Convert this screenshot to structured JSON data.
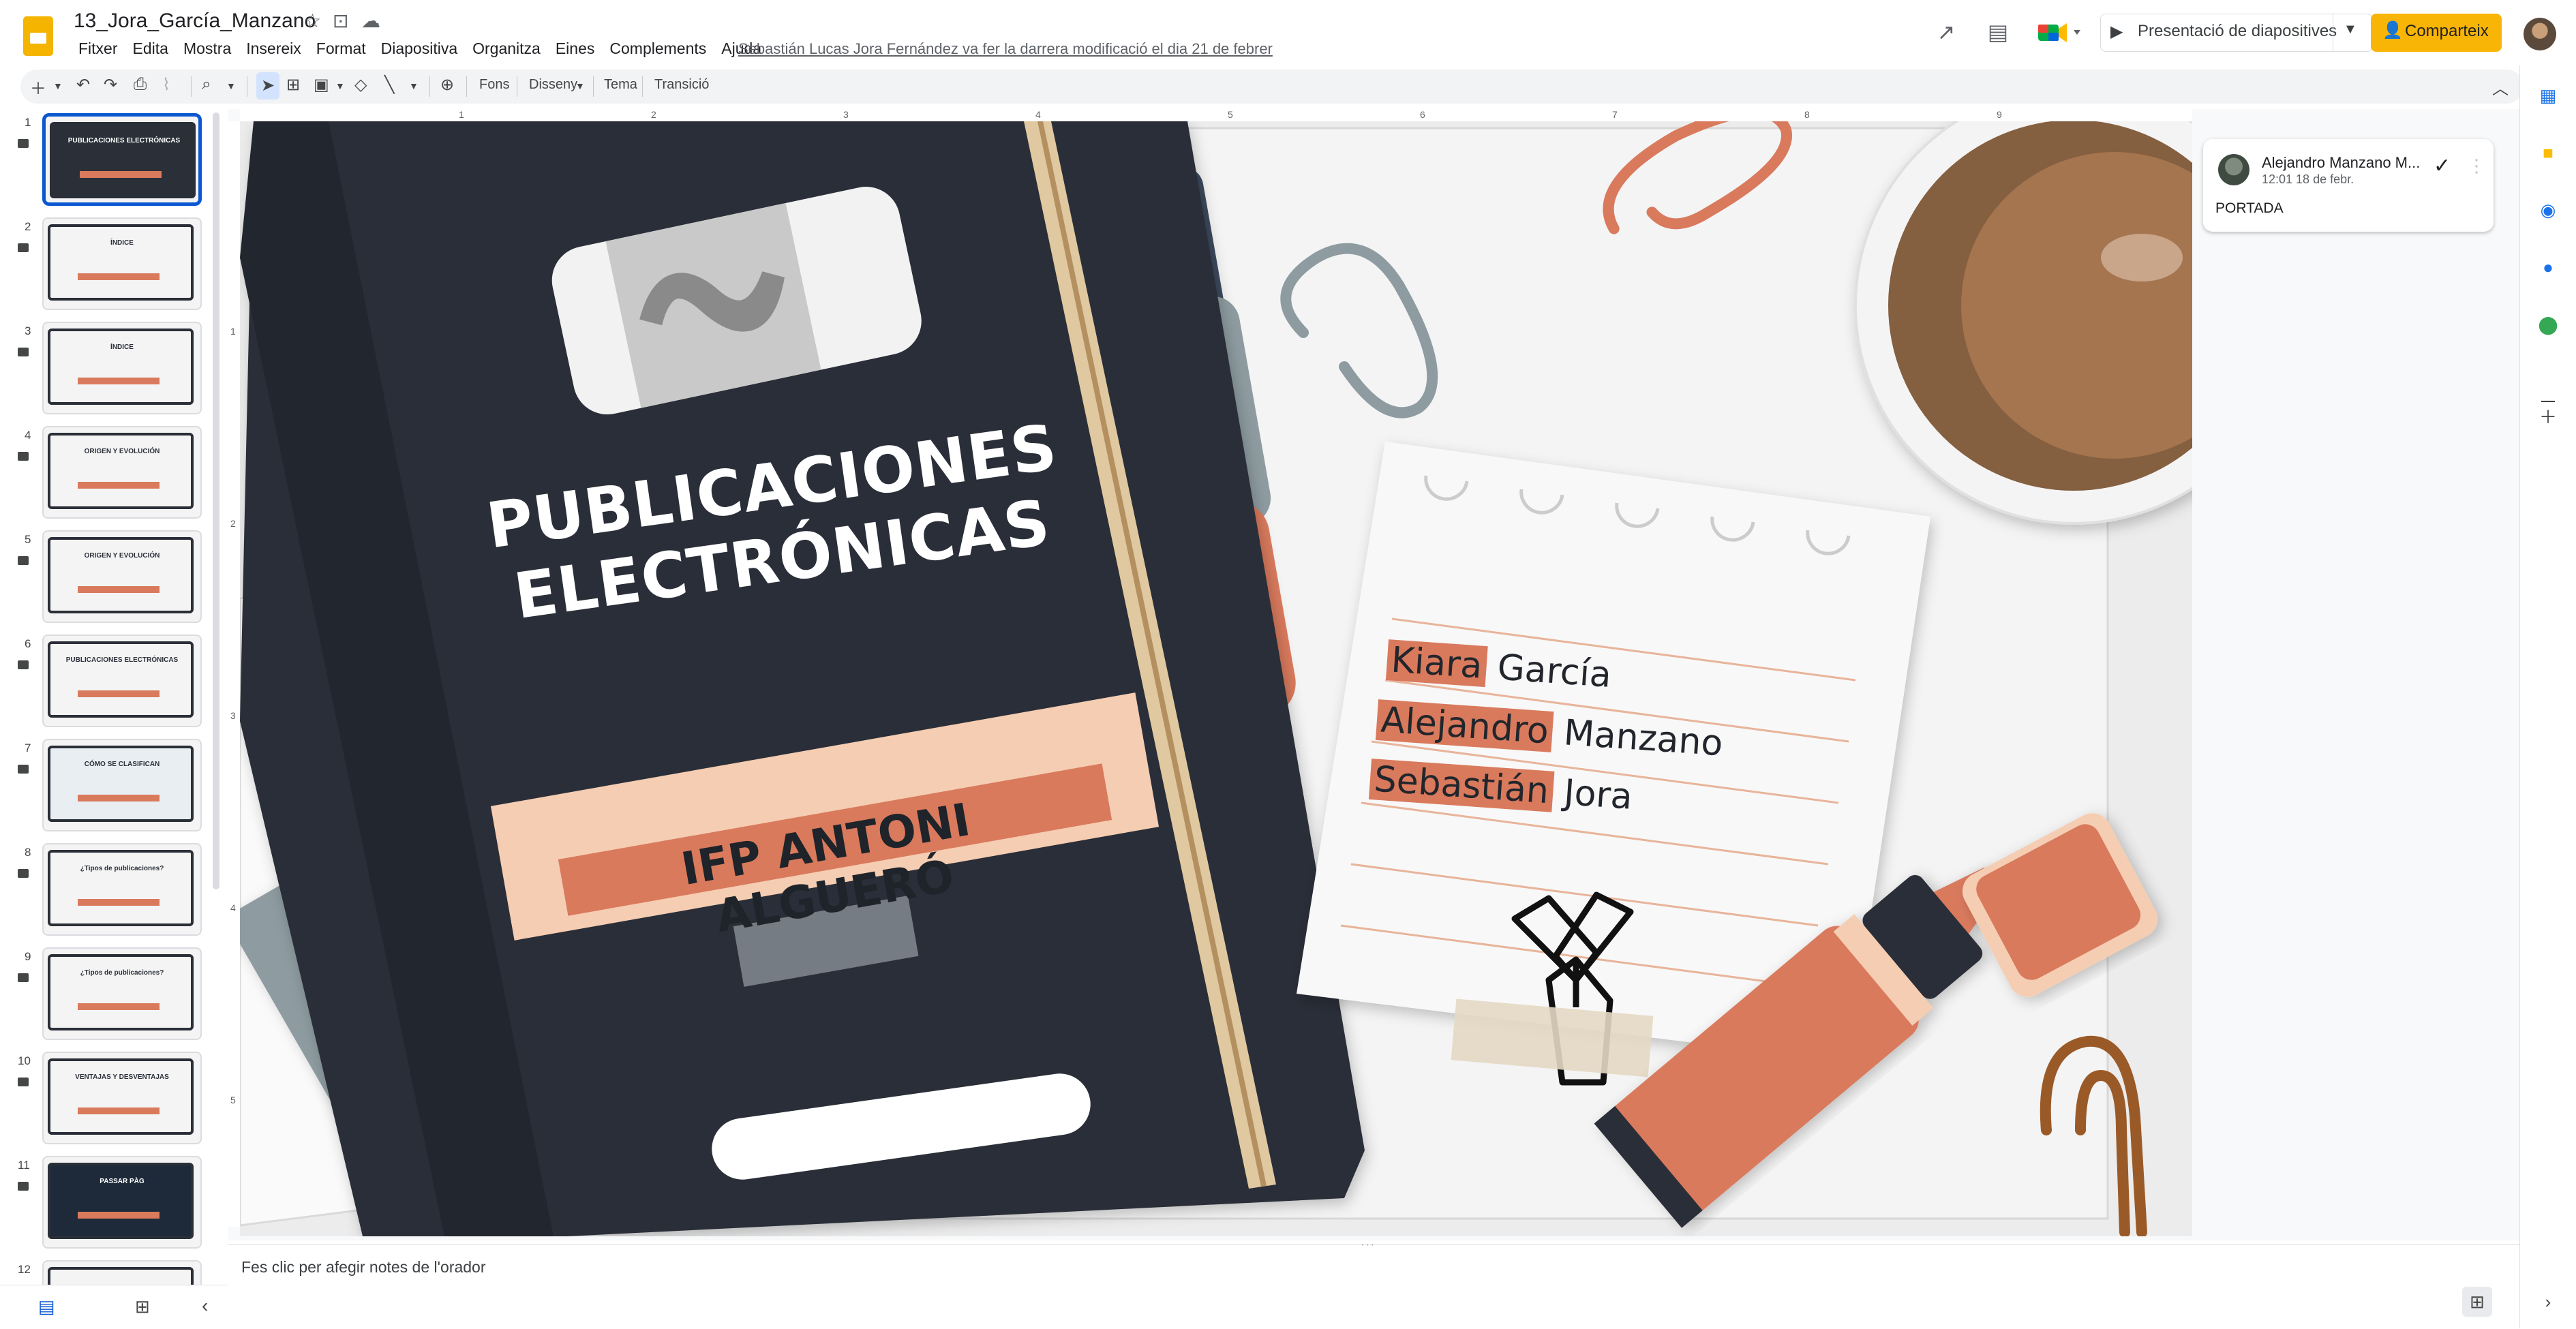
{
  "app": {
    "doc_title": "13_Jora_García_Manzano",
    "menu": [
      "Fitxer",
      "Edita",
      "Mostra",
      "Insereix",
      "Format",
      "Diapositiva",
      "Organitza",
      "Eines",
      "Complements",
      "Ajuda"
    ],
    "last_edit": "Sebastián Lucas Jora Fernández va fer la darrera modificació el dia 21 de febrer",
    "present_label": "Presentació de diapositives",
    "share_label": "Comparteix"
  },
  "toolbar": {
    "background_label": "Fons",
    "layout_label": "Disseny",
    "theme_label": "Tema",
    "transition_label": "Transició"
  },
  "ruler": {
    "top": [
      "1",
      "2",
      "3",
      "4",
      "5",
      "6",
      "7",
      "8",
      "9"
    ],
    "left": [
      "1",
      "2",
      "3",
      "4",
      "5"
    ]
  },
  "filmstrip": {
    "slides": [
      {
        "num": "1",
        "title": "PUBLICACIONES ELECTRÓNICAS"
      },
      {
        "num": "2",
        "title": "ÍNDICE"
      },
      {
        "num": "3",
        "title": "ÍNDICE"
      },
      {
        "num": "4",
        "title": "ORIGEN Y EVOLUCIÓN"
      },
      {
        "num": "5",
        "title": "ORIGEN Y EVOLUCIÓN"
      },
      {
        "num": "6",
        "title": "PUBLICACIONES ELECTRÓNICAS"
      },
      {
        "num": "7",
        "title": "CÓMO SE CLASIFICAN"
      },
      {
        "num": "8",
        "title": "¿Tipos de publicaciones?"
      },
      {
        "num": "9",
        "title": "¿Tipos de publicaciones?"
      },
      {
        "num": "10",
        "title": "VENTAJAS Y DESVENTAJAS"
      },
      {
        "num": "11",
        "title": "PASSAR PÀG"
      },
      {
        "num": "12",
        "title": ""
      }
    ]
  },
  "slide": {
    "title": "PUBLICACIONES ELECTRÓNICAS",
    "school": "IFP ANTONI ALGUERÓ",
    "names": [
      {
        "first": "Kiara",
        "last": "García"
      },
      {
        "first": "Alejandro",
        "last": "Manzano"
      },
      {
        "first": "Sebastián",
        "last": "Jora"
      }
    ]
  },
  "comment": {
    "author": "Alejandro Manzano M...",
    "time": "12:01 18 de febr.",
    "text": "PORTADA"
  },
  "notes": {
    "placeholder": "Fes clic per afegir notes de l'orador"
  },
  "colors": {
    "accent": "#0b57d0",
    "share": "#f9b505",
    "slides_logo": "#f4b400",
    "book": "#2a2f38",
    "terracotta": "#d97a5d",
    "peach": "#f5cdb2"
  }
}
